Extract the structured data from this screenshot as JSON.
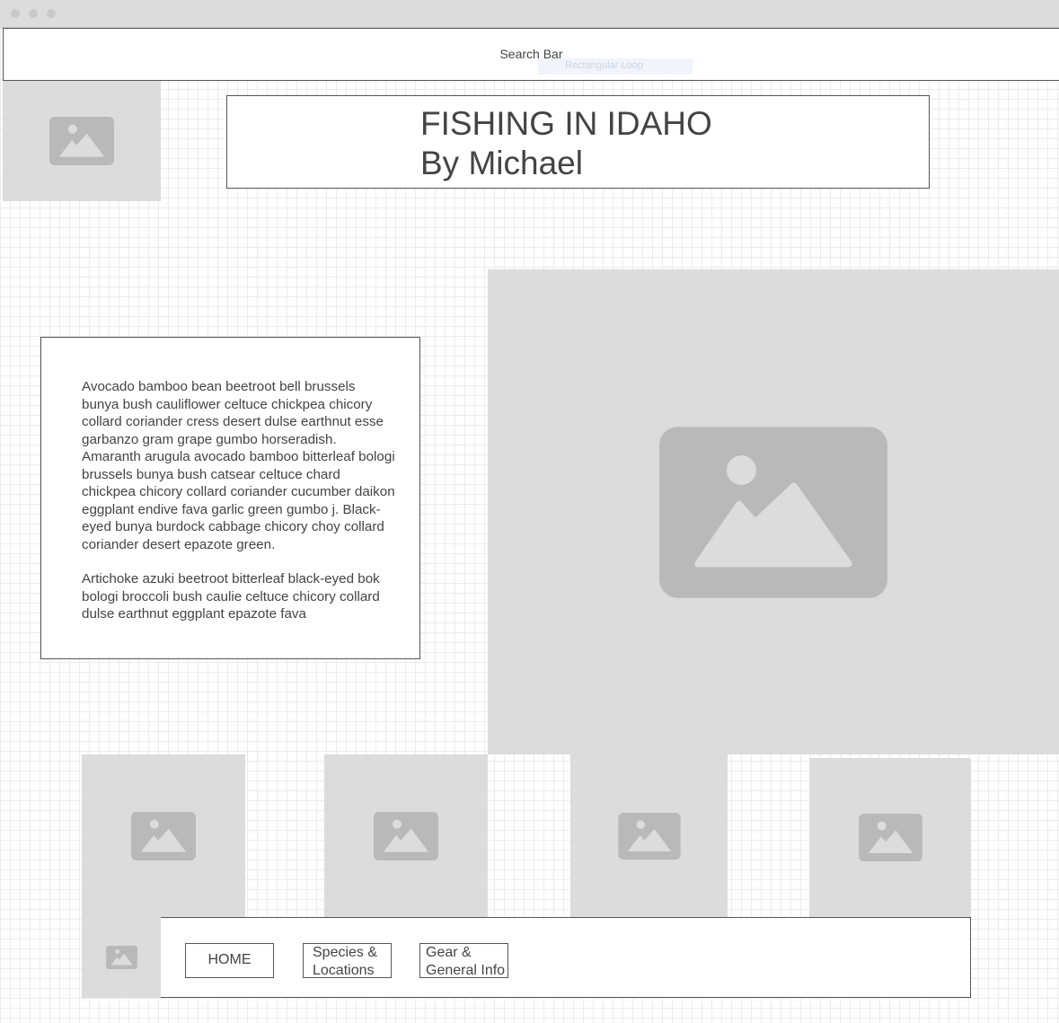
{
  "window": {
    "controls": [
      "close-dot",
      "minimize-dot",
      "zoom-dot"
    ]
  },
  "search": {
    "label": "Search Bar",
    "ghost_tooltip": "Rectangular Loop"
  },
  "header": {
    "title": "FISHING IN IDAHO",
    "subtitle": "By Michael"
  },
  "content": {
    "paragraph_1": "Avocado bamboo bean beetroot bell brussels bunya bush cauliflower celtuce chickpea chicory collard coriander cress desert dulse earthnut esse garbanzo gram grape gumbo horseradish. Amaranth arugula avocado bamboo bitterleaf bologi brussels bunya bush catsear celtuce chard chickpea chicory collard coriander cucumber daikon eggplant endive fava garlic green gumbo j. Black-eyed bunya burdock cabbage chicory choy collard coriander desert epazote green.",
    "paragraph_2": "Artichoke azuki beetroot bitterleaf black-eyed bok bologi broccoli bush caulie celtuce chicory collard dulse earthnut eggplant epazote fava"
  },
  "images": {
    "icon": "image-placeholder-icon",
    "placeholder_color": "#dcdcdc",
    "icon_color": "#b9b9b9"
  },
  "nav": {
    "home": "HOME",
    "species_line1": "Species &",
    "species_line2": "Locations",
    "gear_line1": "Gear &",
    "gear_line2": "General Info"
  }
}
